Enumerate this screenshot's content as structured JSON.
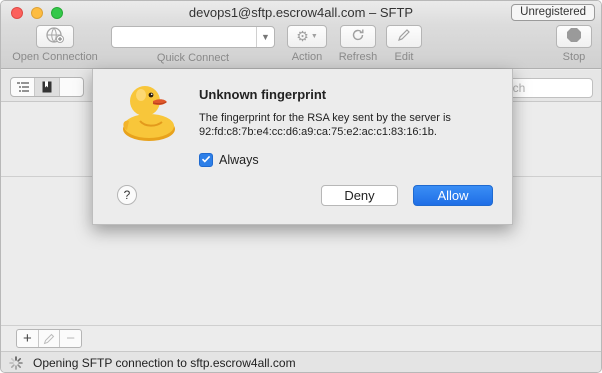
{
  "window": {
    "title": "devops1@sftp.escrow4all.com – SFTP",
    "badge": "Unregistered"
  },
  "toolbar": {
    "open_connection": "Open Connection",
    "quick_connect": "Quick Connect",
    "action": "Action",
    "refresh": "Refresh",
    "edit": "Edit",
    "stop": "Stop"
  },
  "search": {
    "placeholder": "Search",
    "visible_text": "arch"
  },
  "dialog": {
    "title": "Unknown fingerprint",
    "message_line1": "The fingerprint for the RSA key sent by the server is",
    "message_line2": "92:fd:c8:7b:e4:cc:d6:a9:ca:75:e2:ac:c1:83:16:1b.",
    "checkbox_label": "Always",
    "checkbox_checked": true,
    "help_label": "?",
    "deny_label": "Deny",
    "allow_label": "Allow"
  },
  "bottombar": {
    "add": "+",
    "remove": "−"
  },
  "status": {
    "text": "Opening SFTP connection to sftp.escrow4all.com"
  },
  "colors": {
    "accent": "#2d7fe8",
    "close": "#fc605c",
    "minimize": "#fdbc40",
    "maximize": "#34c84a"
  }
}
